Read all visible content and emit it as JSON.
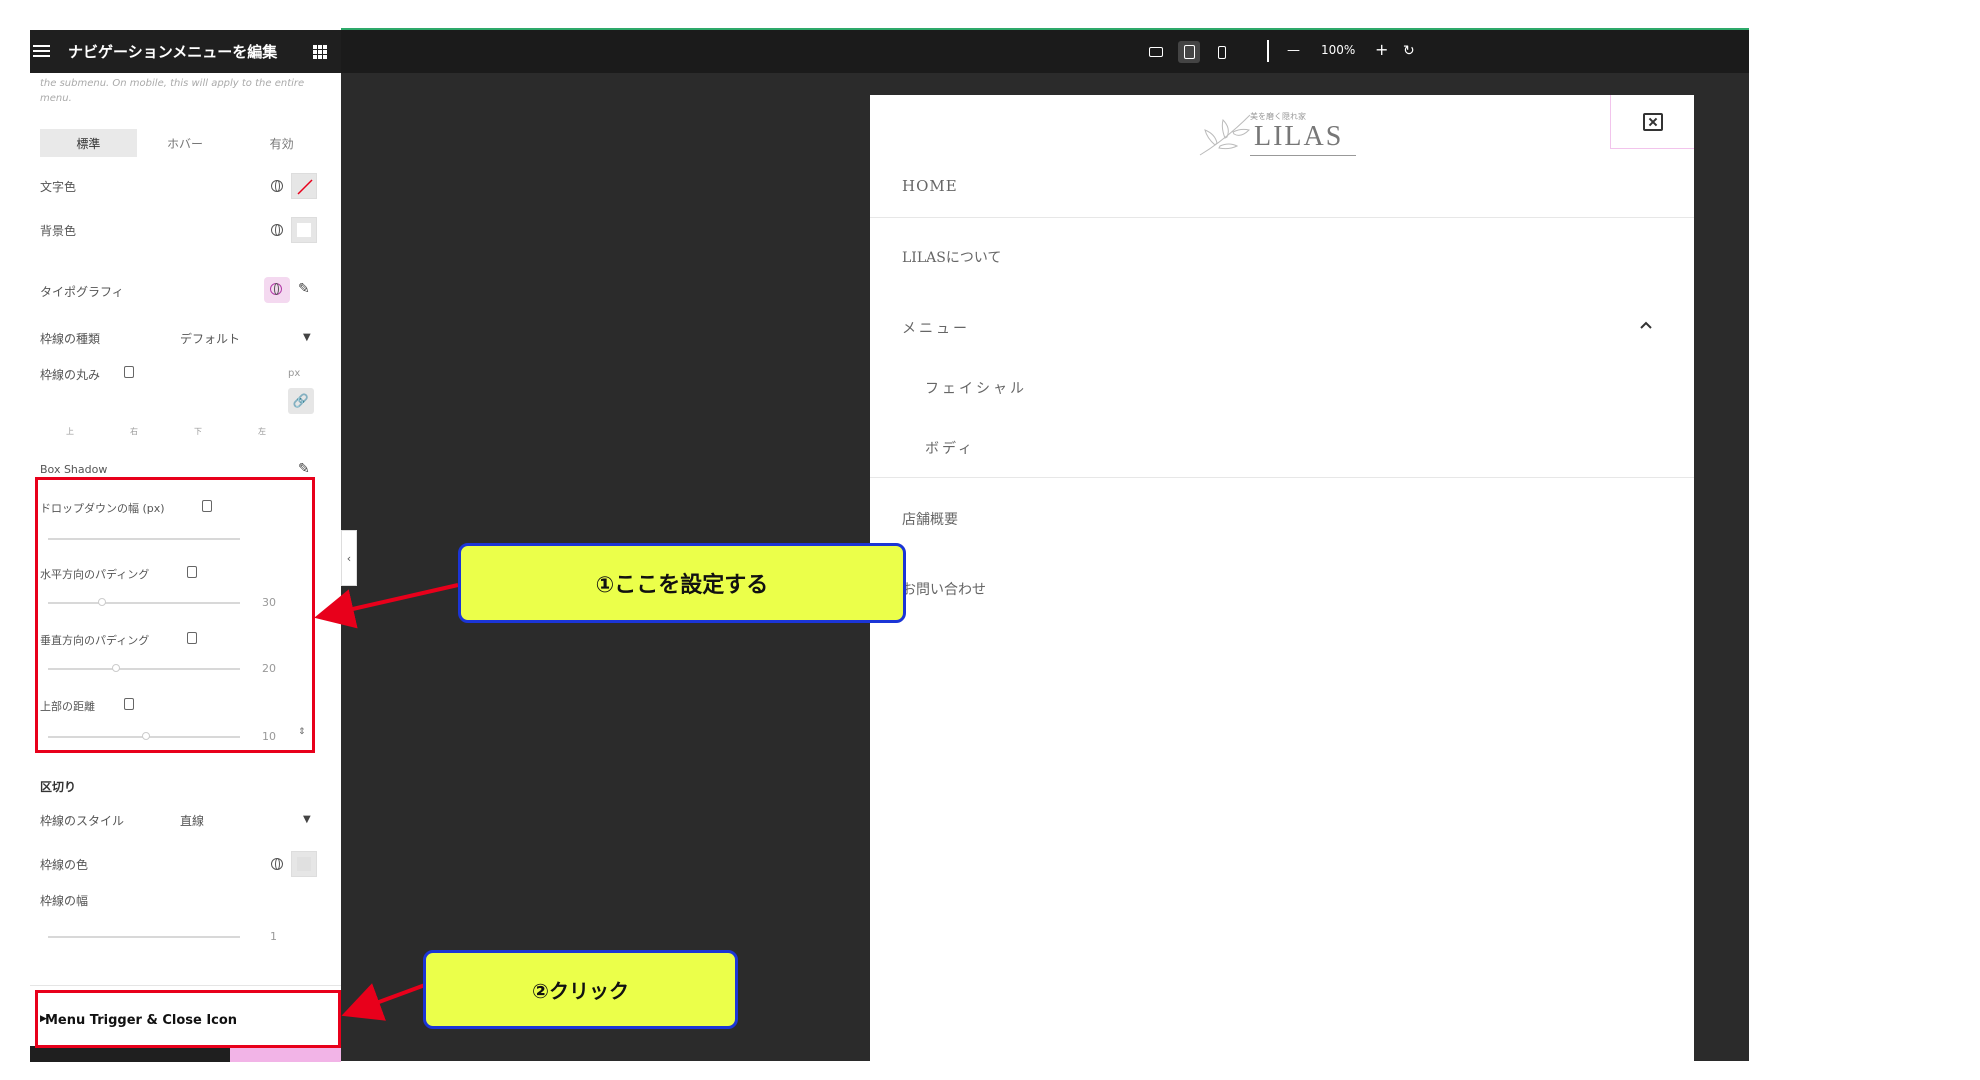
{
  "panel": {
    "title": "ナビゲーションメニューを編集",
    "note": "the submenu. On mobile, this will apply to the entire menu.",
    "tabs": [
      "標準",
      "ホバー",
      "有効"
    ],
    "text_color_label": "文字色",
    "bg_color_label": "背景色",
    "typography_label": "タイポグラフィ",
    "border_type_label": "枠線の種類",
    "border_type_value": "デフォルト",
    "border_radius_label": "枠線の丸み",
    "border_radius_unit": "px",
    "sides": [
      "上",
      "右",
      "下",
      "左"
    ],
    "box_shadow_label": "Box Shadow",
    "dropdown_width_label": "ドロップダウンの幅 (px)",
    "h_padding_label": "水平方向のパディング",
    "h_padding_value": "30",
    "v_padding_label": "垂直方向のパディング",
    "v_padding_value": "20",
    "top_distance_label": "上部の距離",
    "top_distance_value": "10",
    "divider_heading": "区切り",
    "border_style_label": "枠線のスタイル",
    "border_style_value": "直線",
    "border_color_label": "枠線の色",
    "border_width_label": "枠線の幅",
    "border_width_value": "1",
    "menu_trigger_label": "Menu Trigger & Close Icon"
  },
  "toolbar": {
    "minus": "—",
    "zoom": "100%",
    "plus": "+",
    "reset": "↻"
  },
  "preview": {
    "logo_sub": "美を磨く隠れ家",
    "logo": "LILAS",
    "nav": {
      "home": "HOME",
      "about": "LILASについて",
      "menu": "メニュー",
      "facial": "フェイシャル",
      "body": "ボディ",
      "store": "店舗概要",
      "contact": "お問い合わせ"
    }
  },
  "callouts": {
    "first": "①ここを設定する",
    "second": "②クリック"
  },
  "colors": {
    "accent_red": "#e8001b",
    "callout_fill": "#ebff4a",
    "callout_border": "#1b35d6"
  }
}
